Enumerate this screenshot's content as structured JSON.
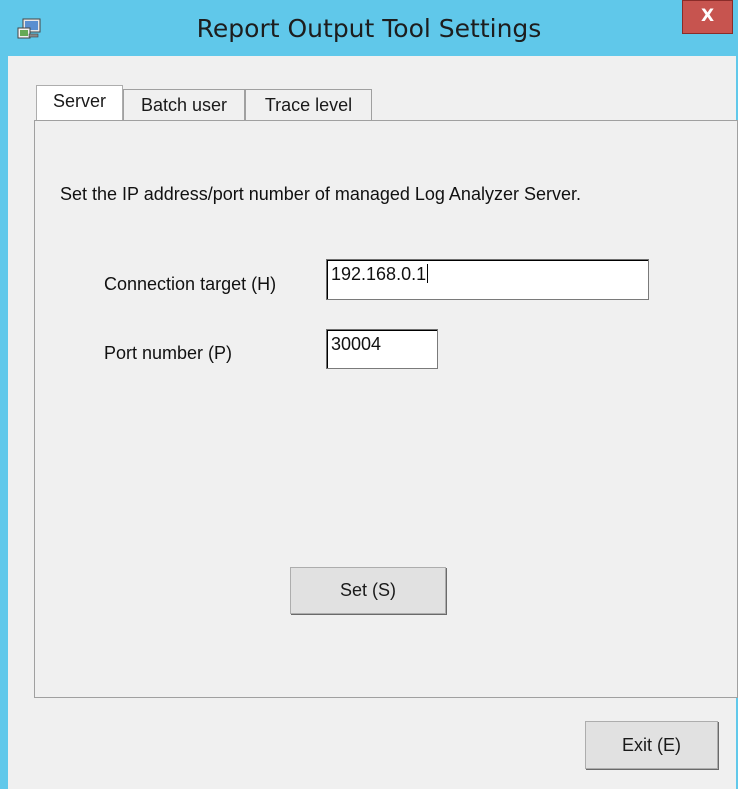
{
  "window": {
    "title": "Report Output Tool Settings",
    "close_label": "X",
    "icon": "app-window-icon"
  },
  "tabs": [
    {
      "label": "Server",
      "active": true
    },
    {
      "label": "Batch user",
      "active": false
    },
    {
      "label": "Trace level",
      "active": false
    }
  ],
  "server_tab": {
    "instruction": "Set the IP address/port number of managed Log Analyzer Server.",
    "connection_target": {
      "label": "Connection target (H)",
      "value": "192.168.0.1"
    },
    "port_number": {
      "label": "Port number (P)",
      "value": "30004"
    },
    "set_button": "Set (S)"
  },
  "footer": {
    "exit_button": "Exit (E)"
  },
  "colors": {
    "titlebar": "#60c8ea",
    "close_button": "#c7544f",
    "client_background": "#f0f0f0"
  }
}
